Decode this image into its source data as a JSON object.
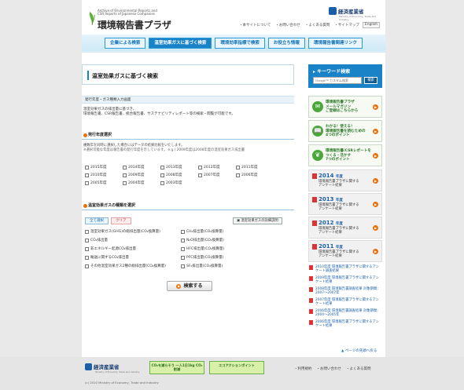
{
  "header": {
    "logo_small_lines": [
      "Archive of Environmental Reports and",
      "CSR Reports of Japanese Companies"
    ],
    "logo_title": "環境報告書プラザ",
    "meti_name": "経済産業省",
    "meti_sub": "Ministry of Economy, Trade and Industry",
    "links": [
      "・本サイトについて",
      "・お問い合わせ",
      "・よくある質問",
      "・サイトマップ"
    ],
    "english": "English"
  },
  "nav": {
    "items": [
      "企業による検索",
      "温室効果ガスに基づく検索",
      "環境効率指標で検索",
      "お役立ち情報",
      "環境報告書関連リンク"
    ]
  },
  "main": {
    "title": "温室効果ガスに基づく検索",
    "sub_bar": "発行年度・ガス種類入力画面",
    "intro_lines": [
      "温室効果ガスの排出量に基づき、",
      "環境報告書、CSR報告書、統合報告書、サステナビリティレポート等の検索・閲覧が可能です。"
    ],
    "year_section": {
      "heading": "発行年度選択",
      "desc": "複数年を同時に選択した場合にはデータの結果比較をいたします。",
      "note": "※選択可能な年度は報告書の発行年度を示しています。 e.g.) 2009年度は2008年度の温室効果ガス排出量",
      "years": [
        "2015年度",
        "2014年度",
        "2013年度",
        "2012年度",
        "2011年度",
        "2010年度",
        "2009年度",
        "2008年度",
        "2007年度",
        "2006年度",
        "2005年度",
        "2004年度",
        "2003年度"
      ]
    },
    "gas_section": {
      "heading": "温室効果ガスの種類を選択",
      "select_all": "全て選択",
      "clear": "クリア",
      "detail_button": "温室効果ガスの詳細説明",
      "gases": [
        "温室効果ガス(GHG)の総排出量(CO₂換算量)",
        "CH₄排出量(CO₂換算量)",
        "CO₂排出量",
        "N₂O排出量(CO₂換算量)",
        "非エネルギー起源CO₂排出量",
        "HFC排出量(CO₂換算量)",
        "輸送に関するCO₂排出量",
        "PFC排出量(CO₂換算量)",
        "その他温室効果ガス2種の総排出量(CO₂換算量)",
        "SF₆排出量(CO₂換算量)"
      ]
    },
    "search_button": "検索する"
  },
  "sidebar": {
    "keyword": {
      "title": "キーワード検索",
      "placeholder": "Google™ カスタム検索",
      "button": "検索"
    },
    "cards": [
      {
        "lines": [
          "環境報告書プラザ",
          "メールマガジン",
          "ご登録はこちらから"
        ]
      },
      {
        "lines": [
          "わかる！使える！",
          "環境報告書を読むための",
          "4つのポイント"
        ]
      },
      {
        "lines": [
          "環境報告書/CSRレポートを",
          "つくる・活かす",
          "7つのポイント"
        ]
      }
    ],
    "year_cards": [
      {
        "year": "2014",
        "unit": "年度",
        "lines": [
          "環境報告書プラザに関する",
          "アンケート結果"
        ]
      },
      {
        "year": "2013",
        "unit": "年度",
        "lines": [
          "環境報告書プラザに関する",
          "アンケート結果"
        ]
      },
      {
        "year": "2012",
        "unit": "年度",
        "lines": [
          "環境報告書プラザに関する",
          "アンケート結果"
        ]
      },
      {
        "year": "2011",
        "unit": "年度",
        "lines": [
          "環境報告書プラザに関する",
          "アンケート結果"
        ]
      }
    ],
    "links": [
      "2010年度 環境報告書プラザに関するアンケート調査結果",
      "2009年度 環境報告書プラザに関するアンケート結果",
      "2008年度 環境報告書調査結果 対象期間：2007～2007年",
      "2007年度 環境報告書プラザに関するアンケート結果",
      "2006年度 環境報告書調査結果 対象期間：2004～2005年",
      "2006年度 環境報告書プラザに関するアンケート結果"
    ]
  },
  "page_top": "ページの先頭へ戻る",
  "footer": {
    "meti_name": "経済産業省",
    "meti_sub": "Ministry of Economy, Trade and Industry",
    "copyright": "(c) 2010 Ministry of Economy, Trade and Industry",
    "banners": [
      "CO₂を減らそう 一人1日1kg CO₂削減",
      "エコアクションポイント"
    ],
    "links": [
      "・利用規約",
      "・お問い合わせ",
      "・よくある質問"
    ]
  }
}
